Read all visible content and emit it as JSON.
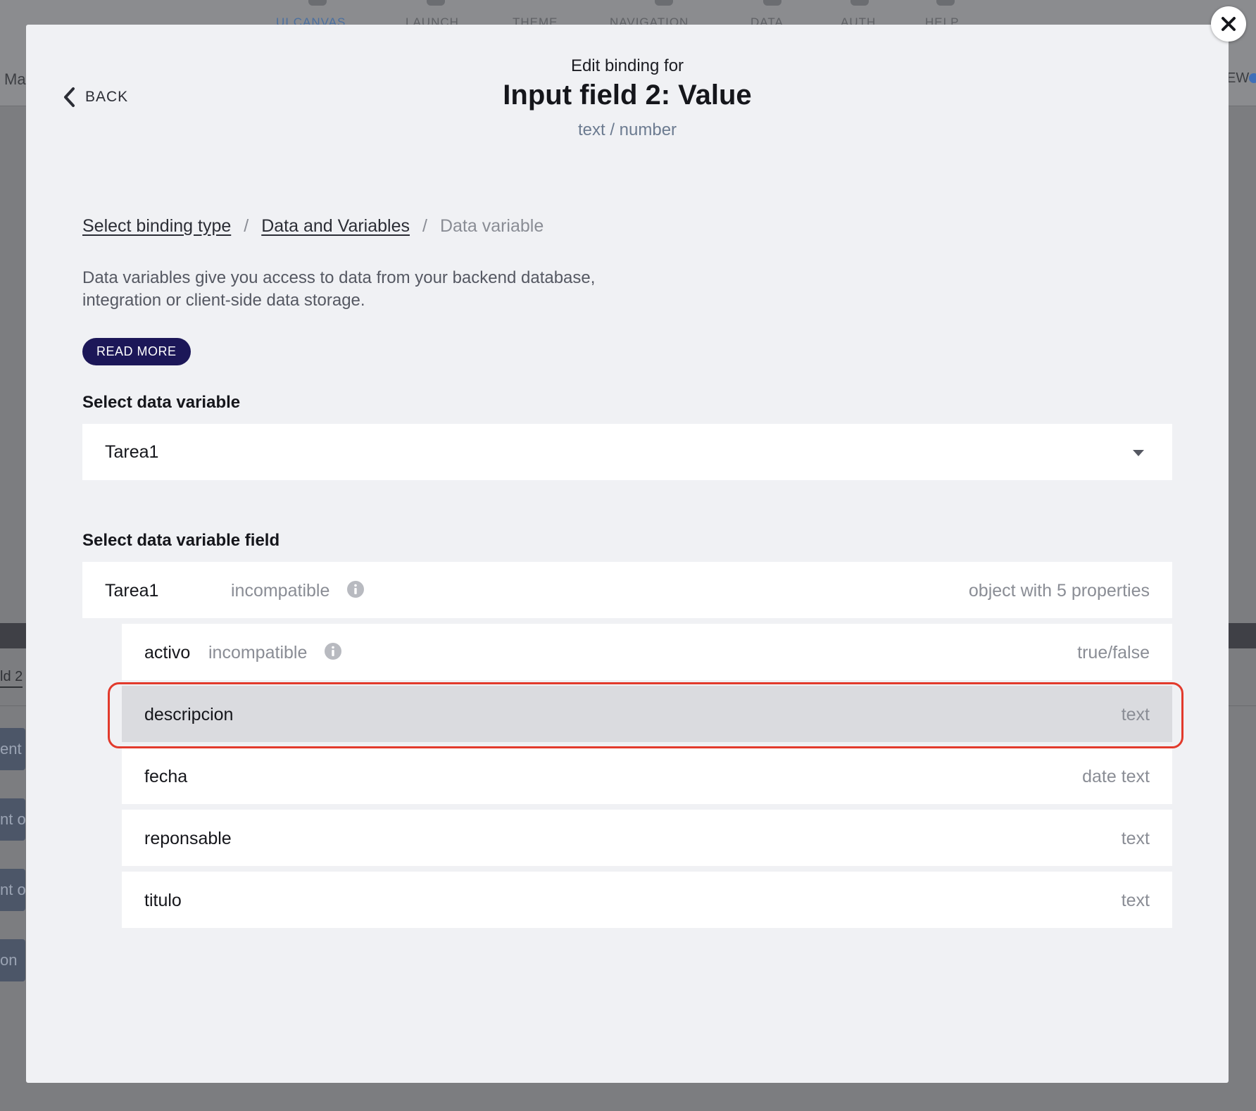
{
  "background": {
    "nav_items": [
      "UI CANVAS",
      "LAUNCH",
      "THEME",
      "NAVIGATION",
      "DATA",
      "AUTH",
      "HELP"
    ],
    "left_text": "Ma",
    "right_text": "EW",
    "field_label": "ld 2",
    "tabs": [
      "ent",
      "nt o",
      "nt o",
      "on"
    ]
  },
  "modal": {
    "back_label": "BACK",
    "header": {
      "subtitle": "Edit binding for",
      "title": "Input field 2: Value",
      "type": "text / number"
    },
    "breadcrumb": {
      "items": [
        "Select binding type",
        "Data and Variables"
      ],
      "separator": "/",
      "current": "Data variable"
    },
    "description": "Data variables give you access to data from your backend database, integration or client-side data storage.",
    "read_more_label": "READ MORE",
    "select_variable": {
      "label": "Select data variable",
      "value": "Tarea1"
    },
    "select_field": {
      "label": "Select data variable field",
      "root": {
        "name": "Tarea1",
        "status": "incompatible",
        "type": "object with 5 properties"
      },
      "fields": [
        {
          "name": "activo",
          "status": "incompatible",
          "type": "true/false"
        },
        {
          "name": "descripcion",
          "status": "",
          "type": "text"
        },
        {
          "name": "fecha",
          "status": "",
          "type": "date text"
        },
        {
          "name": "reponsable",
          "status": "",
          "type": "text"
        },
        {
          "name": "titulo",
          "status": "",
          "type": "text"
        }
      ],
      "selected": "descripcion"
    }
  },
  "colors": {
    "accent": "#1c1758",
    "highlight": "#e23a2c",
    "modal_bg": "#f0f1f4",
    "selected_row": "#dadbdf"
  }
}
